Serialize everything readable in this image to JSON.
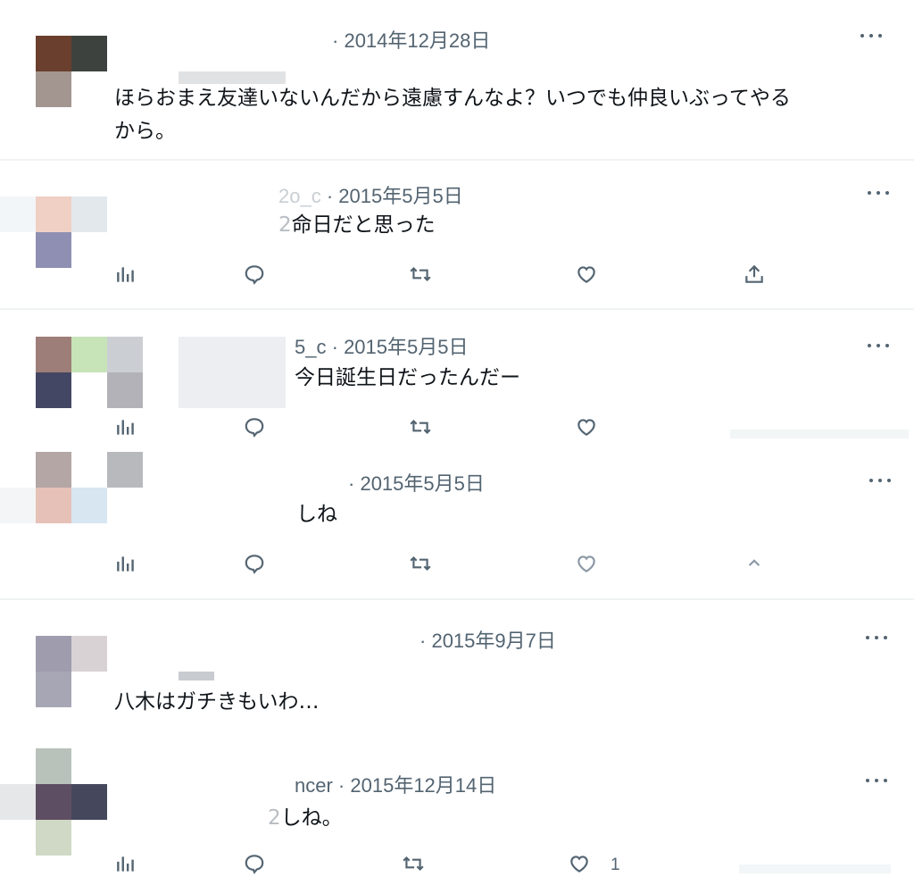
{
  "posts": [
    {
      "handle_tail": "",
      "date": "2014年12月28日",
      "text_l1": "ほらおまえ友達いないんだから遠慮すんなよ？いつでも仲良いぶってやる",
      "text_l2": "から。"
    },
    {
      "handle_tail": "2o_c",
      "date": "2015年5月5日",
      "text_l1": "命日だと思った",
      "lead": "2"
    },
    {
      "handle_tail": "5_c",
      "date": "2015年5月5日",
      "text_l1": "今日誕生日だったんだー"
    },
    {
      "handle_tail": "",
      "date": "2015年5月5日",
      "text_l1": "しね"
    },
    {
      "handle_tail": "",
      "date": "2015年9月7日",
      "text_l1": "八木はガチきもいわ…"
    },
    {
      "handle_tail": "ncer",
      "date": "2015年12月14日",
      "text_l1": "しね。",
      "lead": "2"
    }
  ],
  "separator": "·",
  "like_count_last": "1",
  "icons": [
    "analytics-icon",
    "reply-icon",
    "retweet-icon",
    "like-icon",
    "share-icon",
    "more-icon"
  ],
  "colors": {
    "text": "#0f1419",
    "muted": "#536471",
    "divider": "#eff3f4"
  }
}
